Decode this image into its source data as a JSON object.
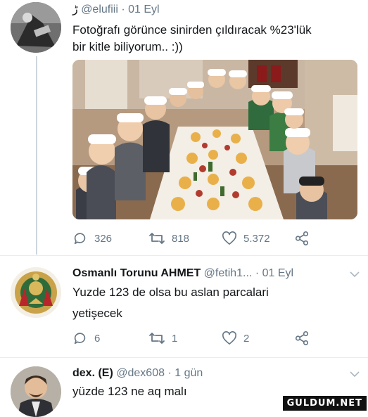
{
  "tweet1": {
    "handle_prefix": "ڑ",
    "handle": "@elufiii",
    "sep": "·",
    "date": "01 Eyl",
    "text_line1": "Fotoğrafı görünce sinirden çıldıracak %23'lük",
    "text_line2": "bir kitle biliyorum.. :))",
    "replies": "326",
    "retweets": "818",
    "likes": "5.372"
  },
  "tweet2": {
    "name": "Osmanlı Torunu AHMET",
    "handle": "@fetih1...",
    "sep": "·",
    "date": "01 Eyl",
    "text_line1": "Yuzde 123 de olsa bu aslan parcalari",
    "text_line2": "yetişecek",
    "replies": "6",
    "retweets": "1",
    "likes": "2"
  },
  "tweet3": {
    "name": "dex. (E)",
    "handle": "@dex608",
    "sep": "·",
    "date": "1 gün",
    "text_line1": "yüzde 123 ne aq malı"
  },
  "watermark": "GULDUM.NET",
  "icons": [
    "reply-icon",
    "retweet-icon",
    "like-icon",
    "share-icon",
    "chevron-down-icon"
  ],
  "colors": {
    "text": "#14171a",
    "muted": "#657786",
    "divider": "#e6ecf0"
  }
}
